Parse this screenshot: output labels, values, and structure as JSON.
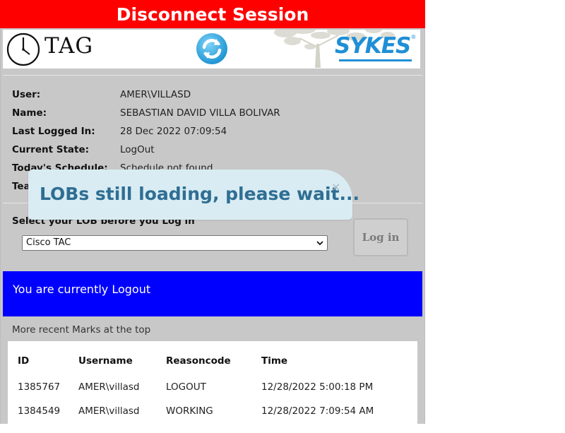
{
  "disconnect_label": "Disconnect Session",
  "header": {
    "logo_text": "TAG",
    "brand_text": "SYKES",
    "brand_mark": "®",
    "brand_color": "#1f8fd6",
    "icons": [
      "clock-icon",
      "refresh-icon"
    ]
  },
  "user_info": {
    "rows": [
      {
        "label": "User:",
        "value": "AMER\\VILLASD"
      },
      {
        "label": "Name:",
        "value": "SEBASTIAN DAVID VILLA BOLIVAR"
      },
      {
        "label": "Last Logged In:",
        "value": "28 Dec 2022 07:09:54"
      },
      {
        "label": "Current State:",
        "value": "LogOut"
      },
      {
        "label": "Today's Schedule:",
        "value": "Schedule not found"
      },
      {
        "label": "Tea",
        "value": ""
      }
    ]
  },
  "lob": {
    "label": "Select your LOB before you Log in",
    "selected": "Cisco TAC"
  },
  "login_label": "Log in",
  "status_text": "You are currently Logout",
  "status_color": "#0000ff",
  "recent_note": "More recent Marks at the top",
  "table": {
    "headers": [
      "ID",
      "Username",
      "Reasoncode",
      "Time"
    ],
    "rows": [
      [
        "1385767",
        "AMER\\villasd",
        "LOGOUT",
        "12/28/2022 5:00:18 PM"
      ],
      [
        "1384549",
        "AMER\\villasd",
        "WORKING",
        "12/28/2022 7:09:54 AM"
      ]
    ]
  },
  "toast": {
    "message": "LOBs still loading, please wait...",
    "close_glyph": "×"
  },
  "disconnect_color": "#ff0000"
}
